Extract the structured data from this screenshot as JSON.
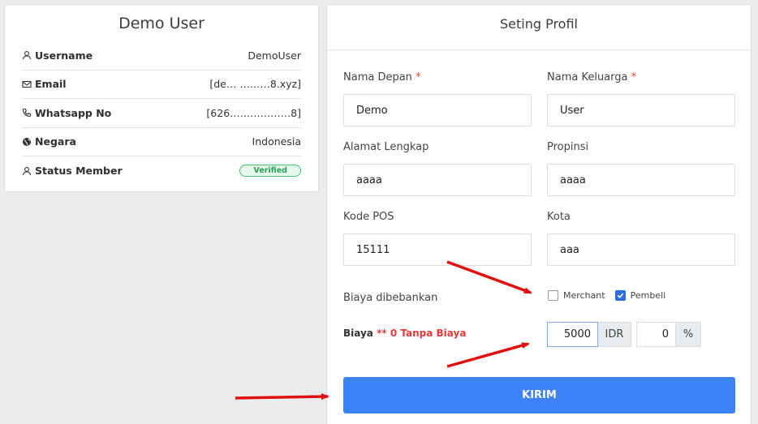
{
  "left_card": {
    "title": "Demo User",
    "rows": [
      {
        "label": "Username",
        "value": "DemoUser",
        "icon": "user-icon"
      },
      {
        "label": "Email",
        "value": "[de…   ………8.xyz]",
        "icon": "mail-icon"
      },
      {
        "label": "Whatsapp No",
        "value": "[626………………8]",
        "icon": "phone-icon"
      },
      {
        "label": "Negara",
        "value": "Indonesia",
        "icon": "globe-icon"
      },
      {
        "label": "Status Member",
        "value": "Verified",
        "icon": "user-icon"
      }
    ]
  },
  "right_card": {
    "title": "Seting Profil",
    "fields": {
      "nama_depan": {
        "label": "Nama Depan",
        "value": "Demo",
        "required": "*"
      },
      "nama_keluarga": {
        "label": "Nama Keluarga",
        "value": "User",
        "required": "*"
      },
      "alamat": {
        "label": "Alamat Lengkap",
        "value": "aaaa"
      },
      "propinsi": {
        "label": "Propinsi",
        "value": "aaaa"
      },
      "kode_pos": {
        "label": "Kode POS",
        "value": "15111"
      },
      "kota": {
        "label": "Kota",
        "value": "aaa"
      }
    },
    "biaya_dibebankan": {
      "label": "Biaya dibebankan",
      "merchant": {
        "label": "Merchant",
        "checked": false
      },
      "pembeli": {
        "label": "Pembeli",
        "checked": true
      }
    },
    "biaya": {
      "label": "Biaya",
      "note": "** 0 Tanpa Biaya",
      "amount": "5000",
      "currency": "IDR",
      "percent": "0",
      "percent_symbol": "%"
    },
    "submit_label": "KIRIM"
  },
  "colors": {
    "accent": "#3d83f7",
    "required": "#e23a3a",
    "verified": "#2c9f55",
    "arrow": "#e01010"
  }
}
